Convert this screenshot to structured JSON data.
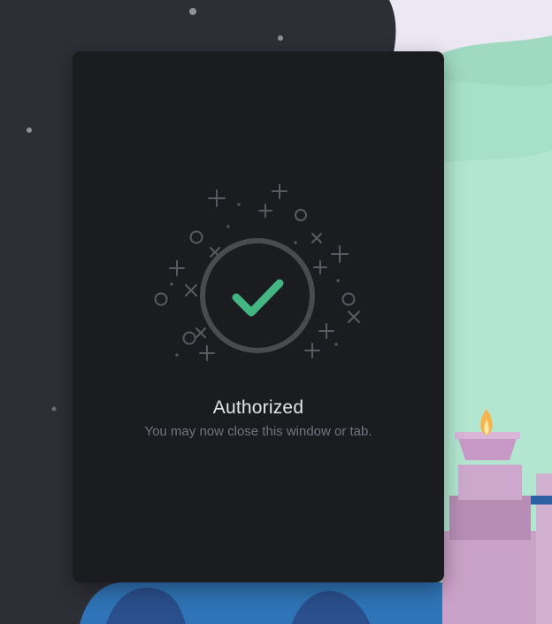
{
  "auth": {
    "title": "Authorized",
    "subtitle": "You may now close this window or tab."
  },
  "icons": {
    "status": "check-circle-icon",
    "decoration": "sparkles-icon"
  },
  "colors": {
    "card_background": "#1b1c20",
    "check_green": "#43b581",
    "ring_gray": "#4a4b4f",
    "title_text": "#e4e5e8",
    "subtitle_text": "#72757d"
  }
}
